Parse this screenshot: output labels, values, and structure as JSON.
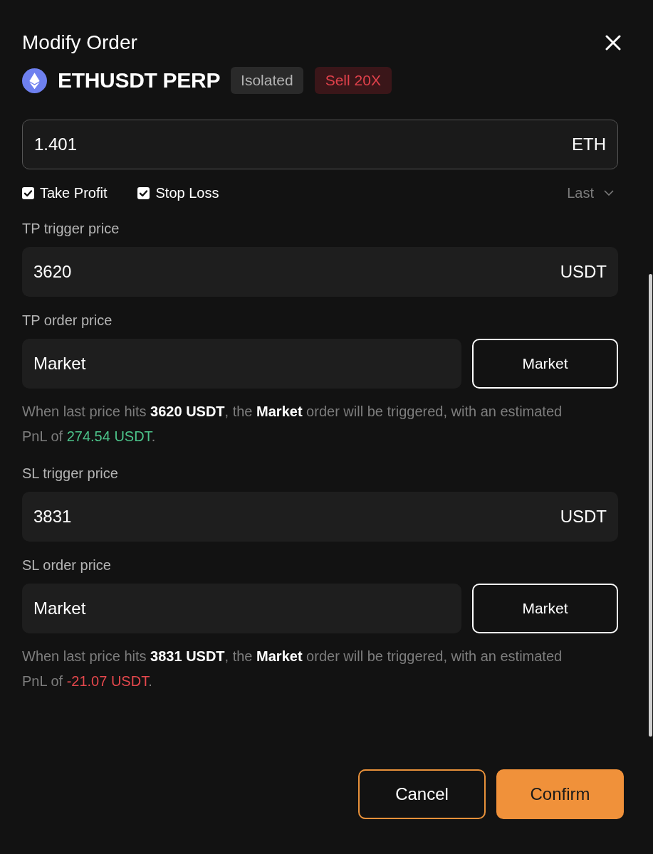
{
  "dialog": {
    "title": "Modify Order"
  },
  "instrument": {
    "symbol": "ETHUSDT PERP",
    "badges": [
      {
        "label": "Isolated",
        "kind": "margin"
      },
      {
        "label": "Sell 20X",
        "kind": "side"
      }
    ]
  },
  "amount": {
    "value": "1.401",
    "unit": "ETH"
  },
  "options": {
    "checkboxes": [
      {
        "label": "Take Profit",
        "checked": true
      },
      {
        "label": "Stop Loss",
        "checked": true
      }
    ],
    "price_type": "Last"
  },
  "sections": [
    {
      "trigger_label": "TP trigger price",
      "trigger_value": "3620",
      "trigger_unit": "USDT",
      "order_label": "TP order price",
      "order_value": "Market",
      "order_type_button": "Market",
      "note": {
        "text": "When last price hits **3620 USDT**, the **Market** order will be triggered, with an estimated PnL of",
        "pnl": {
          "value": "274.54 USDT",
          "color": "#4cc38a"
        },
        "end": "."
      }
    },
    {
      "trigger_label": "SL trigger price",
      "trigger_value": "3831",
      "trigger_unit": "USDT",
      "order_label": "SL order price",
      "order_value": "Market",
      "order_type_button": "Market",
      "note": {
        "text": "When last price hits **3831 USDT**, the **Market** order will be triggered, with an estimated PnL of",
        "pnl": {
          "value": "-21.07 USDT",
          "color": "#e5484d"
        },
        "end": "."
      }
    }
  ],
  "buttons": [
    {
      "label": "Cancel",
      "kind": "secondary"
    },
    {
      "label": "Confirm",
      "kind": "primary"
    }
  ]
}
